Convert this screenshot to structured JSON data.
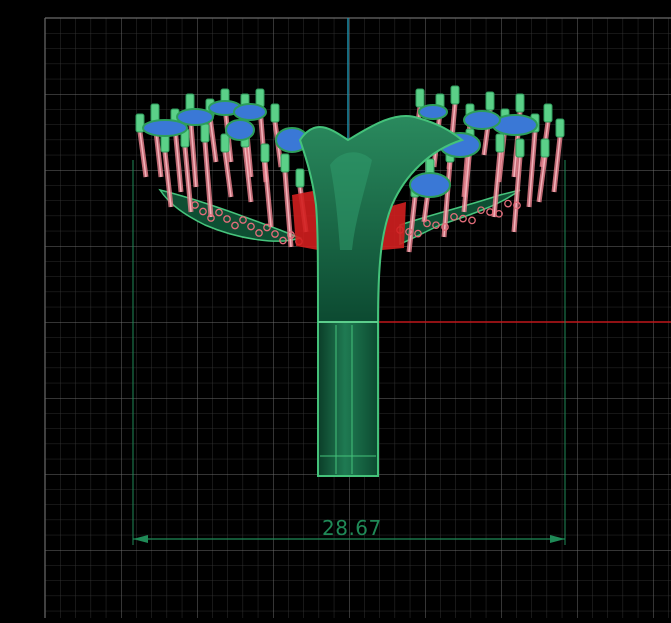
{
  "viewport": {
    "background": "#000000",
    "grid_color": "#4a4a4a",
    "axis_x_color": "#c0171b",
    "axis_y_color": "#1e8ea8",
    "model_color": "#0f5a3a",
    "outline_color": "#44c27a"
  },
  "dimension": {
    "value_text": "28.67",
    "color": "#1f8a57"
  }
}
